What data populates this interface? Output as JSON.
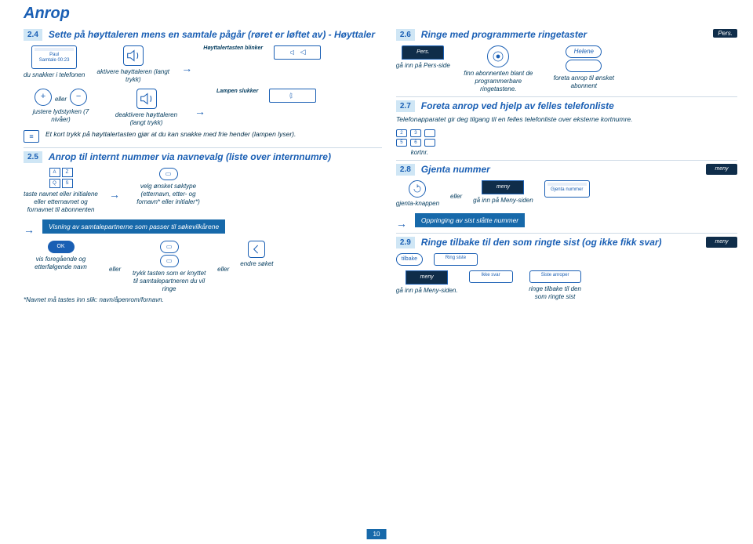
{
  "page_title": "Anrop",
  "page_number": "10",
  "sections": {
    "s24": {
      "num": "2.4",
      "title": "Sette på høyttaleren mens en samtale pågår (røret er løftet av) - Høyttaler"
    },
    "s26": {
      "num": "2.6",
      "title": "Ringe med programmerte ringetaster"
    },
    "s27": {
      "num": "2.7",
      "title": "Foreta anrop ved hjelp av felles telefonliste"
    },
    "s25": {
      "num": "2.5",
      "title": "Anrop til internt nummer via navnevalg (liste over internnumre)"
    },
    "s28": {
      "num": "2.8",
      "title": "Gjenta nummer"
    },
    "s29": {
      "num": "2.9",
      "title": "Ringe tilbake til den som ringte sist (og ikke fikk svar)"
    }
  },
  "s24": {
    "lcd_name": "Paul",
    "lcd_call": "Samtale 00:23",
    "du_snakker": "du snakker i telefonen",
    "aktiver": "aktivere høyttaleren (langt trykk)",
    "blinker": "Høyttalertasten blinker",
    "juster": "justere lydstyrken (7 nivåer)",
    "deaktiver": "deaktivere høyttaleren (langt trykk)",
    "slukker": "Lampen slukker",
    "eller": "eller",
    "note": "Et kort trykk på høyttalertasten gjør at du kan snakke med frie hender (lampen lyser)."
  },
  "s26": {
    "pers_tab": "Pers.",
    "helene": "Helene",
    "ga_inn": "gå inn på Pers-side",
    "finn": "finn abonnenten blant de programmerbare ringetastene.",
    "foreta": "foreta anrop til ønsket abonnent"
  },
  "s27": {
    "body": "Telefonapparatet gir deg tilgang til en felles telefonliste over eksterne kortnumre.",
    "kortnr": "kortnr."
  },
  "s25": {
    "taste": "taste navnet eller initialene eller etternavnet og fornavnet til abonnenten",
    "velg": "velg ønsket søktype (etternavn, etter- og fornavn* eller initialer*)",
    "visning": "Visning av samtalepartnerne som passer til søkevilkårene",
    "vis_nav": "vis foregående og etterfølgende navn",
    "trykk": "trykk tasten som er knyttet til samtalepartneren du vil ringe",
    "endre": "endre søket",
    "ok": "OK",
    "eller": "eller",
    "footnote": "*Navnet må tastes inn slik: navn/åpenrom/fornavn."
  },
  "s28": {
    "meny": "meny",
    "gjenta_knapp": "gjenta-knappen",
    "ga_inn": "gå inn på Meny-siden",
    "header_lcd": "Gjenta nummer",
    "oppringing": "Oppringing av sist slåtte nummer",
    "eller": "eller"
  },
  "s29": {
    "meny": "meny",
    "tilbake_btn": "tilbake",
    "ring_siste": "Ring siste",
    "ikke_svar": "Ikke svar",
    "siste_anrop": "Siste anroper",
    "ga_inn": "gå inn på Meny-siden.",
    "ringe_tilbake": "ringe tilbake til den som ringte sist"
  }
}
